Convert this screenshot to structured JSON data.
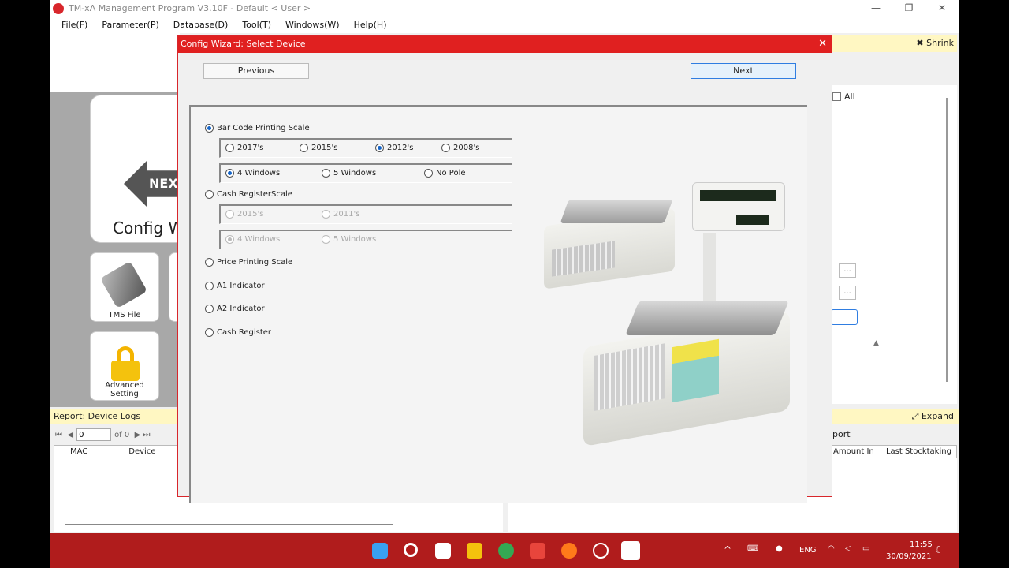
{
  "window": {
    "title": "TM-xA Management Program V3.10F - Default < User >",
    "minimize": "—",
    "maximize": "❐",
    "close": "✕"
  },
  "menu": [
    "File(F)",
    "Parameter(P)",
    "Database(D)",
    "Tool(T)",
    "Windows(W)",
    "Help(H)"
  ],
  "left_panel": {
    "config_tile_arrow": "NEXT",
    "config_tile_label": "Config W",
    "tms_file_label": "TMS File",
    "advanced_setting_label": "Advanced Setting"
  },
  "right_panel": {
    "shrink_label": "Shrink",
    "all_checkbox": "All",
    "browse_button": "...",
    "expand_label": "Expand",
    "port_label": "port",
    "columns": [
      "Amount In",
      "Last Stocktaking"
    ]
  },
  "report": {
    "title": "Report: Device Logs",
    "page_value": "0",
    "page_of": "of 0",
    "columns": [
      "MAC",
      "Device Name"
    ]
  },
  "dialog": {
    "title": "Config Wizard: Select Device",
    "close": "✕",
    "previous_label": "Previous",
    "next_label": "Next",
    "options": {
      "bar_code": "Bar Code Printing Scale",
      "bar_years": [
        "2017's",
        "2015's",
        "2012's",
        "2008's"
      ],
      "bar_windows": [
        "4 Windows",
        "5 Windows",
        "No Pole"
      ],
      "cash_register_scale": "Cash RegisterScale",
      "crs_years": [
        "2015's",
        "2011's"
      ],
      "crs_windows": [
        "4 Windows",
        "5 Windows"
      ],
      "price_printing": "Price Printing Scale",
      "a1": "A1 Indicator",
      "a2": "A2 Indicator",
      "cash_register": "Cash Register"
    }
  },
  "taskbar": {
    "lang": "ENG",
    "time": "11:55",
    "date": "30/09/2021"
  },
  "colors": {
    "accent_red": "#e02020",
    "taskbar": "#b01c1c",
    "radio_selected": "#1464c8"
  }
}
